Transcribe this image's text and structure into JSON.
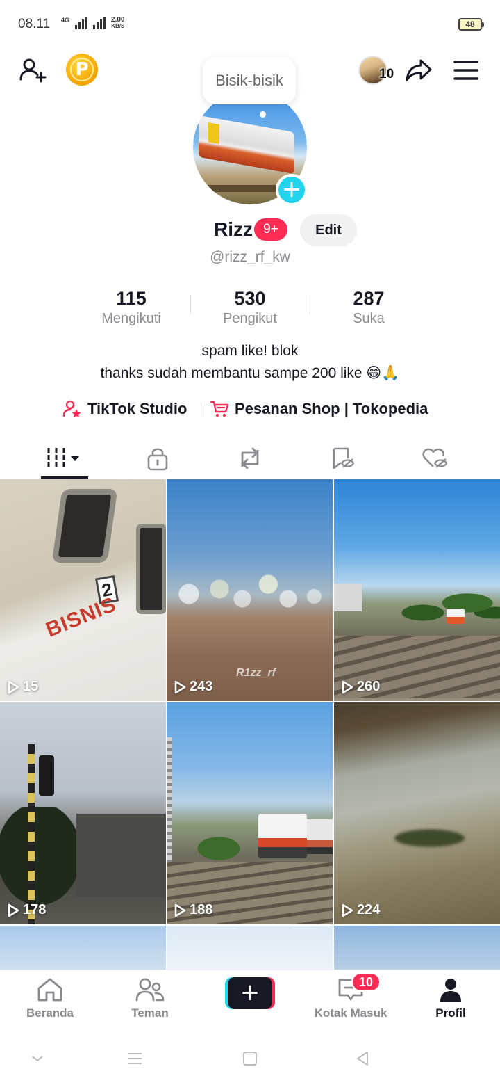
{
  "status_bar": {
    "time": "08.11",
    "network": "4G",
    "speed_value": "2.00",
    "speed_unit": "KB/S",
    "battery": "48"
  },
  "profile": {
    "note_bubble": "Bisik-bisik",
    "name": "Rizz",
    "name_badge": "9+",
    "edit_label": "Edit",
    "handle": "@rizz_rf_kw",
    "story_count": "10",
    "stats": [
      {
        "value": "115",
        "label": "Mengikuti"
      },
      {
        "value": "530",
        "label": "Pengikut"
      },
      {
        "value": "287",
        "label": "Suka"
      }
    ],
    "bio_lines": [
      "spam like! blok",
      "thanks sudah membantu sampe 200 like 😁🙏"
    ]
  },
  "links": [
    {
      "label": "TikTok Studio",
      "icon": "creator-star-icon"
    },
    {
      "label": "Pesanan Shop | Tokopedia",
      "icon": "cart-icon"
    }
  ],
  "tabs": [
    {
      "name": "videos",
      "icon": "grid-videos-icon",
      "active": true
    },
    {
      "name": "private",
      "icon": "lock-icon"
    },
    {
      "name": "reposts",
      "icon": "repost-icon"
    },
    {
      "name": "favorites",
      "icon": "bookmark-hidden-icon"
    },
    {
      "name": "liked",
      "icon": "heart-hidden-icon"
    }
  ],
  "videos": [
    {
      "views": "15",
      "watermark": ""
    },
    {
      "views": "243",
      "watermark": "R1zz_rf"
    },
    {
      "views": "260",
      "watermark": ""
    },
    {
      "views": "178",
      "watermark": ""
    },
    {
      "views": "188",
      "watermark": ""
    },
    {
      "views": "224",
      "watermark": ""
    }
  ],
  "bottom_nav": [
    {
      "label": "Beranda",
      "icon": "home-icon"
    },
    {
      "label": "Teman",
      "icon": "friends-icon"
    },
    {
      "label": "",
      "icon": "create-plus-icon"
    },
    {
      "label": "Kotak Masuk",
      "icon": "inbox-icon",
      "badge": "10"
    },
    {
      "label": "Profil",
      "icon": "profile-icon",
      "active": true
    }
  ],
  "colors": {
    "accent_red": "#fe2c55",
    "accent_cyan": "#20d5ec",
    "text_primary": "#161823",
    "text_secondary": "#8a8b91"
  }
}
